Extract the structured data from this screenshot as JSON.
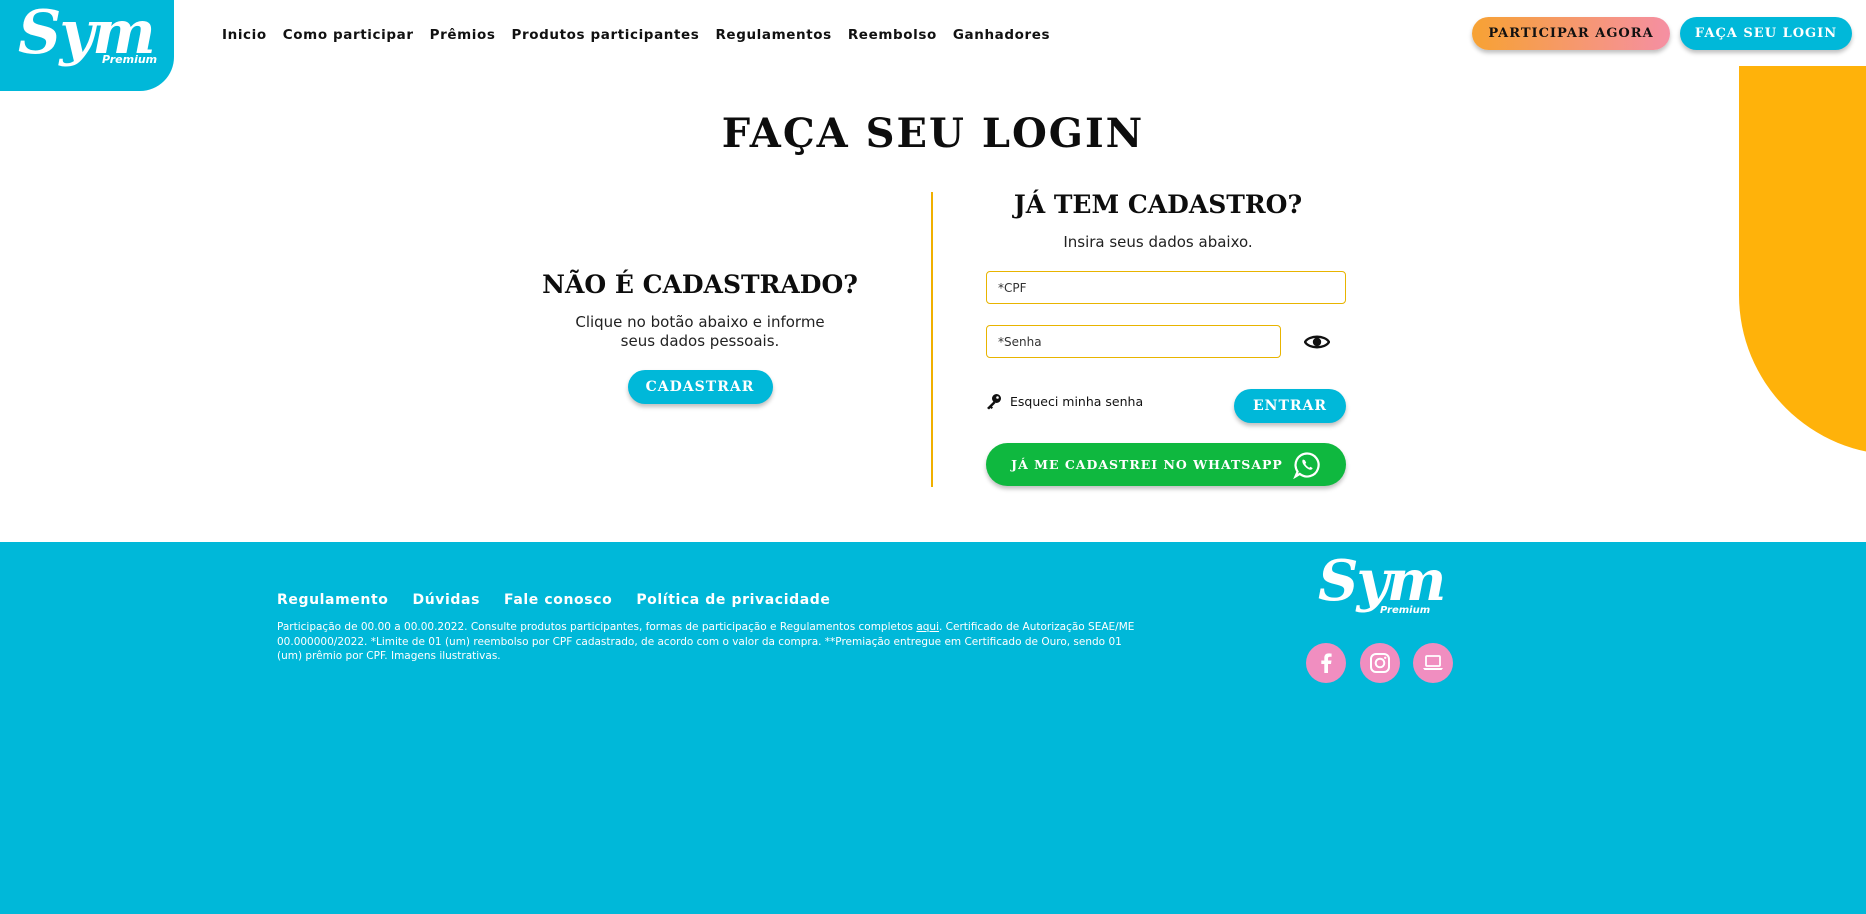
{
  "brand": {
    "name": "Sym",
    "sub": "Premium"
  },
  "nav": {
    "items": [
      "Inicio",
      "Como participar",
      "Prêmios",
      "Produtos participantes",
      "Regulamentos",
      "Reembolso",
      "Ganhadores"
    ]
  },
  "header": {
    "participar_label": "PARTICIPAR AGORA",
    "login_label": "FAÇA SEU LOGIN"
  },
  "page": {
    "title": "FAÇA SEU LOGIN"
  },
  "register": {
    "heading": "NÃO É CADASTRADO?",
    "text_line1": "Clique no botão abaixo e informe",
    "text_line2": "seus dados pessoais.",
    "button_label": "CADASTRAR"
  },
  "login": {
    "heading": "JÁ TEM CADASTRO?",
    "subtitle": "Insira seus dados abaixo.",
    "cpf_placeholder": "*CPF",
    "password_placeholder": "*Senha",
    "forgot_label": "Esqueci minha senha",
    "submit_label": "ENTRAR",
    "whatsapp_label": "JÁ ME CADASTREI NO WHATSAPP"
  },
  "footer": {
    "links": [
      "Regulamento",
      "Dúvidas",
      "Fale conosco",
      "Política de privacidade"
    ],
    "disclaimer_part1": "Participação de 00.00 a 00.00.2022. Consulte produtos participantes, formas de participação e Regulamentos completos ",
    "disclaimer_link": "aqui",
    "disclaimer_part2": ". Certificado de Autorização SEAE/ME 00.000000/2022. *Limite de 01 (um) reembolso por CPF cadastrado, de acordo com o valor da compra. **Premiação entregue em Certificado de Ouro, sendo 01 (um) prêmio por CPF. Imagens ilustrativas.",
    "social": [
      "facebook-icon",
      "instagram-icon",
      "laptop-icon"
    ]
  },
  "colors": {
    "primary": "#00b8d9",
    "accent_yellow": "#ffb20a",
    "whatsapp_green": "#0fb83f",
    "social_pink": "#f08ec0",
    "input_border": "#e8b400"
  }
}
